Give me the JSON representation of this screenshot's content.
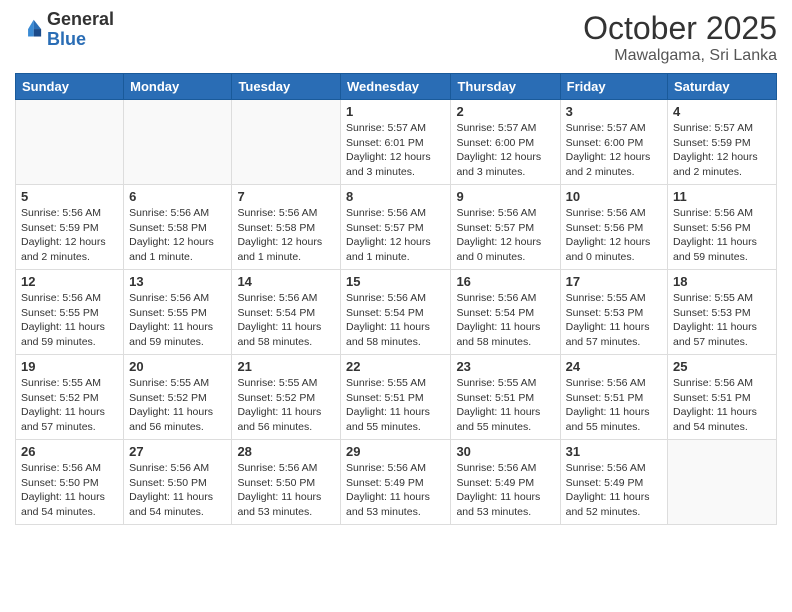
{
  "header": {
    "logo_general": "General",
    "logo_blue": "Blue",
    "month": "October 2025",
    "location": "Mawalgama, Sri Lanka"
  },
  "days_of_week": [
    "Sunday",
    "Monday",
    "Tuesday",
    "Wednesday",
    "Thursday",
    "Friday",
    "Saturday"
  ],
  "weeks": [
    [
      {
        "day": "",
        "info": ""
      },
      {
        "day": "",
        "info": ""
      },
      {
        "day": "",
        "info": ""
      },
      {
        "day": "1",
        "info": "Sunrise: 5:57 AM\nSunset: 6:01 PM\nDaylight: 12 hours\nand 3 minutes."
      },
      {
        "day": "2",
        "info": "Sunrise: 5:57 AM\nSunset: 6:00 PM\nDaylight: 12 hours\nand 3 minutes."
      },
      {
        "day": "3",
        "info": "Sunrise: 5:57 AM\nSunset: 6:00 PM\nDaylight: 12 hours\nand 2 minutes."
      },
      {
        "day": "4",
        "info": "Sunrise: 5:57 AM\nSunset: 5:59 PM\nDaylight: 12 hours\nand 2 minutes."
      }
    ],
    [
      {
        "day": "5",
        "info": "Sunrise: 5:56 AM\nSunset: 5:59 PM\nDaylight: 12 hours\nand 2 minutes."
      },
      {
        "day": "6",
        "info": "Sunrise: 5:56 AM\nSunset: 5:58 PM\nDaylight: 12 hours\nand 1 minute."
      },
      {
        "day": "7",
        "info": "Sunrise: 5:56 AM\nSunset: 5:58 PM\nDaylight: 12 hours\nand 1 minute."
      },
      {
        "day": "8",
        "info": "Sunrise: 5:56 AM\nSunset: 5:57 PM\nDaylight: 12 hours\nand 1 minute."
      },
      {
        "day": "9",
        "info": "Sunrise: 5:56 AM\nSunset: 5:57 PM\nDaylight: 12 hours\nand 0 minutes."
      },
      {
        "day": "10",
        "info": "Sunrise: 5:56 AM\nSunset: 5:56 PM\nDaylight: 12 hours\nand 0 minutes."
      },
      {
        "day": "11",
        "info": "Sunrise: 5:56 AM\nSunset: 5:56 PM\nDaylight: 11 hours\nand 59 minutes."
      }
    ],
    [
      {
        "day": "12",
        "info": "Sunrise: 5:56 AM\nSunset: 5:55 PM\nDaylight: 11 hours\nand 59 minutes."
      },
      {
        "day": "13",
        "info": "Sunrise: 5:56 AM\nSunset: 5:55 PM\nDaylight: 11 hours\nand 59 minutes."
      },
      {
        "day": "14",
        "info": "Sunrise: 5:56 AM\nSunset: 5:54 PM\nDaylight: 11 hours\nand 58 minutes."
      },
      {
        "day": "15",
        "info": "Sunrise: 5:56 AM\nSunset: 5:54 PM\nDaylight: 11 hours\nand 58 minutes."
      },
      {
        "day": "16",
        "info": "Sunrise: 5:56 AM\nSunset: 5:54 PM\nDaylight: 11 hours\nand 58 minutes."
      },
      {
        "day": "17",
        "info": "Sunrise: 5:55 AM\nSunset: 5:53 PM\nDaylight: 11 hours\nand 57 minutes."
      },
      {
        "day": "18",
        "info": "Sunrise: 5:55 AM\nSunset: 5:53 PM\nDaylight: 11 hours\nand 57 minutes."
      }
    ],
    [
      {
        "day": "19",
        "info": "Sunrise: 5:55 AM\nSunset: 5:52 PM\nDaylight: 11 hours\nand 57 minutes."
      },
      {
        "day": "20",
        "info": "Sunrise: 5:55 AM\nSunset: 5:52 PM\nDaylight: 11 hours\nand 56 minutes."
      },
      {
        "day": "21",
        "info": "Sunrise: 5:55 AM\nSunset: 5:52 PM\nDaylight: 11 hours\nand 56 minutes."
      },
      {
        "day": "22",
        "info": "Sunrise: 5:55 AM\nSunset: 5:51 PM\nDaylight: 11 hours\nand 55 minutes."
      },
      {
        "day": "23",
        "info": "Sunrise: 5:55 AM\nSunset: 5:51 PM\nDaylight: 11 hours\nand 55 minutes."
      },
      {
        "day": "24",
        "info": "Sunrise: 5:56 AM\nSunset: 5:51 PM\nDaylight: 11 hours\nand 55 minutes."
      },
      {
        "day": "25",
        "info": "Sunrise: 5:56 AM\nSunset: 5:51 PM\nDaylight: 11 hours\nand 54 minutes."
      }
    ],
    [
      {
        "day": "26",
        "info": "Sunrise: 5:56 AM\nSunset: 5:50 PM\nDaylight: 11 hours\nand 54 minutes."
      },
      {
        "day": "27",
        "info": "Sunrise: 5:56 AM\nSunset: 5:50 PM\nDaylight: 11 hours\nand 54 minutes."
      },
      {
        "day": "28",
        "info": "Sunrise: 5:56 AM\nSunset: 5:50 PM\nDaylight: 11 hours\nand 53 minutes."
      },
      {
        "day": "29",
        "info": "Sunrise: 5:56 AM\nSunset: 5:49 PM\nDaylight: 11 hours\nand 53 minutes."
      },
      {
        "day": "30",
        "info": "Sunrise: 5:56 AM\nSunset: 5:49 PM\nDaylight: 11 hours\nand 53 minutes."
      },
      {
        "day": "31",
        "info": "Sunrise: 5:56 AM\nSunset: 5:49 PM\nDaylight: 11 hours\nand 52 minutes."
      },
      {
        "day": "",
        "info": ""
      }
    ]
  ]
}
